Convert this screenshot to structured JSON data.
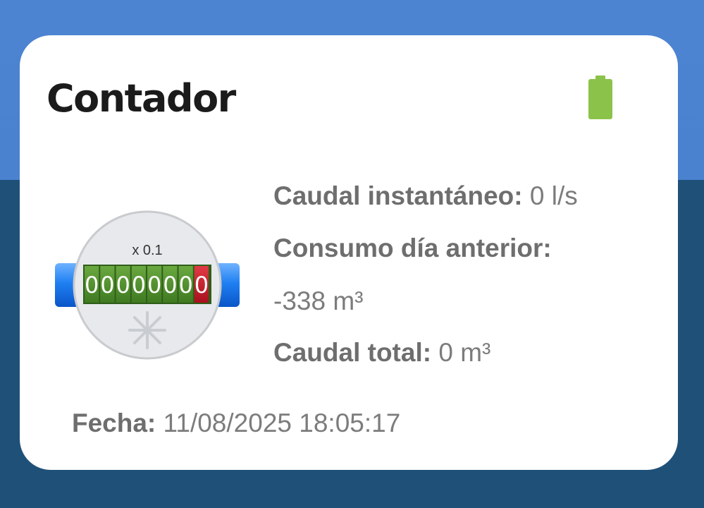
{
  "card": {
    "title": "Contador",
    "battery_icon": "battery-full-icon",
    "battery_color": "#8bc34a"
  },
  "meter": {
    "multiplier": "x 0.1",
    "digits": [
      "0",
      "0",
      "0",
      "0",
      "0",
      "0",
      "0"
    ],
    "decimal_digit": "0",
    "digit_color": "#4e8f2a",
    "decimal_color": "#c8202f",
    "pipe_color": "#1a7cf0",
    "indicator_icon": "asterisk-icon"
  },
  "info": {
    "caudal_label": "Caudal instantáneo:",
    "caudal_value": " 0 l/s",
    "consumo_label": "Consumo día anterior:",
    "consumo_value": "-338 m³",
    "total_label": "Caudal total:",
    "total_value": " 0 m³"
  },
  "fecha": {
    "label": "Fecha:",
    "value": " 11/08/2025 18:05:17"
  },
  "colors": {
    "background_top": "#4c84d2",
    "background_bottom": "#1f5078",
    "card": "#ffffff"
  }
}
